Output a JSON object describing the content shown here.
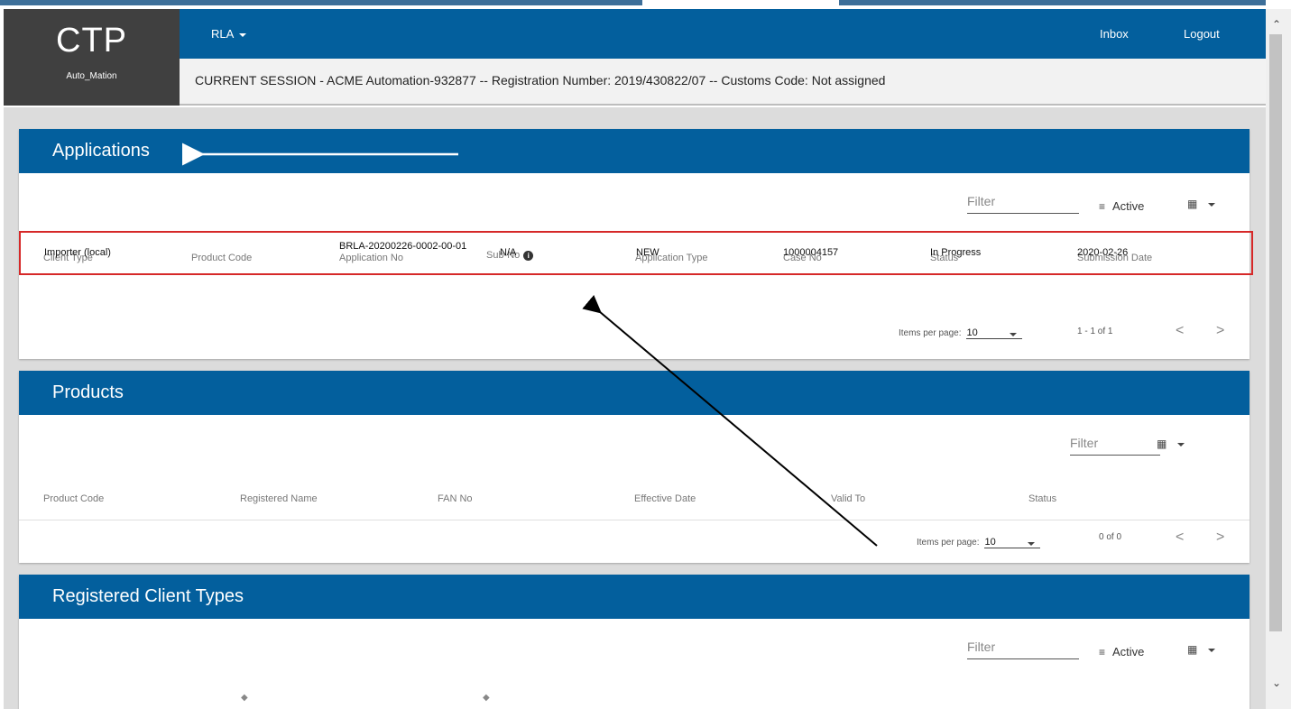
{
  "brand": {
    "name": "CTP",
    "sub": "Auto_Mation"
  },
  "nav": {
    "menu": "RLA",
    "inbox": "Inbox",
    "logout": "Logout"
  },
  "session": "CURRENT SESSION - ACME Automation-932877 -- Registration Number: 2019/430822/07 -- Customs Code: Not assigned",
  "applications": {
    "title": "Applications",
    "filter_placeholder": "Filter",
    "active_label": "Active",
    "columns": [
      "Client Type",
      "Product Code",
      "Application No",
      "Sub-No",
      "Application Type",
      "Case No",
      "Status",
      "Submission Date"
    ],
    "rows": [
      [
        "Importer (local)",
        "",
        "BRLA-20200226-0002-00-01",
        "N/A",
        "NEW",
        "1000004157",
        "In Progress",
        "2020-02-26"
      ]
    ],
    "items_per_page_label": "Items per page:",
    "items_per_page": "10",
    "range": "1 - 1 of 1"
  },
  "products": {
    "title": "Products",
    "filter_placeholder": "Filter",
    "columns": [
      "Product Code",
      "Registered Name",
      "FAN No",
      "Effective Date",
      "Valid To",
      "Status"
    ],
    "items_per_page_label": "Items per page:",
    "items_per_page": "10",
    "range": "0 of 0"
  },
  "client_types": {
    "title": "Registered Client Types",
    "filter_placeholder": "Filter",
    "active_label": "Active"
  },
  "colors": {
    "primary": "#035f9d",
    "logo_bg": "#404040",
    "highlight": "#d62828"
  }
}
